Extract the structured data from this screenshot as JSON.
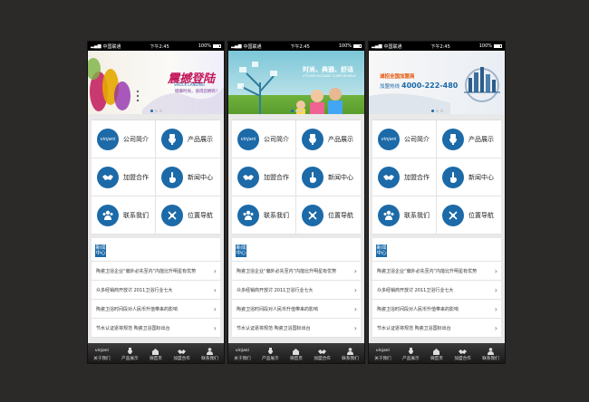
{
  "status": {
    "carrier": "中国联通",
    "time": "下午2:45",
    "battery": "100%"
  },
  "brand_logo": "vinjani",
  "phones": [
    {
      "banner": {
        "headline": "震撼登陆",
        "headline_sub": "SHOCK LANDING",
        "tagline": "健康时尚，值得您拥有！"
      },
      "menu": [
        "公司简介",
        "产品展示",
        "加盟合作",
        "新闻中心",
        "联系我们",
        "位置导航"
      ],
      "news_tag": "新闻中心",
      "news": [
        "陶瓷卫浴企业“偏外必先至内”内能比升明星有优势",
        "众多经销商开放讨 2011卫浴行业七大",
        "陶瓷卫浴时间段对人民币升值带来的影响",
        "节水认证逐将规范 陶瓷卫浴国标出台"
      ],
      "tabs": [
        "关于我们",
        "产品展示",
        "微首页",
        "加盟合作",
        "联系我们"
      ]
    },
    {
      "banner": {
        "headline": "时尚、典雅、舒适",
        "headline_sub": "STYLISH ELEGANT COMFORTABLE"
      },
      "menu": [
        "公司简介",
        "产品展示",
        "加盟合作",
        "新闻中心",
        "联系我们",
        "位置导航"
      ],
      "news_tag": "新闻中心",
      "news": [
        "陶瓷卫浴企业“偏外必先至内”内能比升明星有优势",
        "众多经销商开放讨 2011卫浴行业七大",
        "陶瓷卫浴时间段对人民币升值带来的影响",
        "节水认证逐将规范 陶瓷卫浴国标出台"
      ],
      "tabs": [
        "关于我们",
        "产品展示",
        "微首页",
        "加盟合作",
        "联系我们"
      ]
    },
    {
      "banner": {
        "headline": "诚招全国加盟商",
        "hotline_label": "加盟热线",
        "hotline": "4000-222-480"
      },
      "menu": [
        "公司简介",
        "产品展示",
        "加盟合作",
        "新闻中心",
        "联系我们",
        "位置导航"
      ],
      "news_tag": "新闻中心",
      "news": [
        "陶瓷卫浴企业“偏外必先至内”内能比升明星有优势",
        "众多经销商开放讨 2011卫浴行业七大",
        "陶瓷卫浴时间段对人民币升值带来的影响",
        "节水认证逐将规范 陶瓷卫浴国标出台"
      ],
      "tabs": [
        "关于我们",
        "产品展示",
        "微首页",
        "加盟合作",
        "联系我们"
      ]
    }
  ],
  "icons": [
    "vinjani-logo-icon",
    "toilet-icon",
    "handshake-icon",
    "hand-pointer-icon",
    "people-icon",
    "compass-icon"
  ],
  "colors": {
    "accent": "#1c6aa8",
    "background": "#2b2a28"
  }
}
